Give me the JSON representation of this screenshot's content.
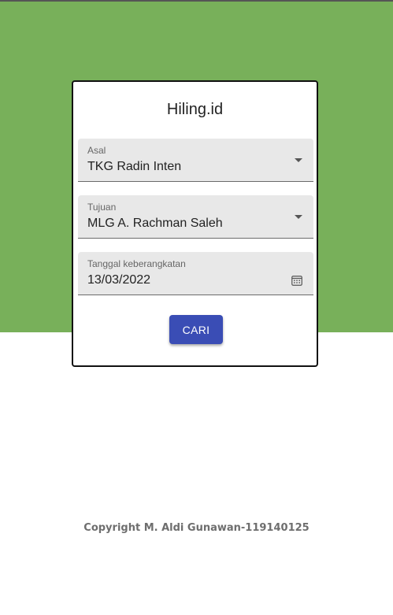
{
  "app": {
    "title": "Hiling.id"
  },
  "form": {
    "origin": {
      "label": "Asal",
      "value": "TKG Radin Inten",
      "icon": "caret-down-icon"
    },
    "destination": {
      "label": "Tujuan",
      "value": "MLG A. Rachman Saleh",
      "icon": "caret-down-icon"
    },
    "departure_date": {
      "label": "Tanggal keberangkatan",
      "value": "13/03/2022",
      "icon": "calendar-icon"
    },
    "submit_label": "CARI"
  },
  "footer": {
    "copyright": "Copyright M. Aldi Gunawan-119140125"
  },
  "colors": {
    "header_background": "#78b05a",
    "button": "#3a4db5",
    "field_background": "#e8e8e8"
  }
}
